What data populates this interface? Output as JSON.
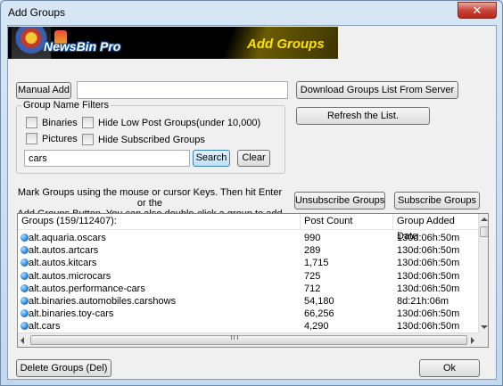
{
  "window": {
    "title": "Add Groups",
    "close_glyph": "✕"
  },
  "banner": {
    "logo_text": "NewsBin Pro",
    "title": "Add Groups"
  },
  "manual_add": {
    "label": "Manual Add",
    "value": ""
  },
  "server_buttons": {
    "download": "Download Groups List From Server",
    "refresh": "Refresh the List."
  },
  "filters": {
    "legend": "Group Name Filters",
    "binaries": "Binaries",
    "pictures": "Pictures",
    "hide_low": "Hide Low Post Groups(under 10,000)",
    "hide_subscribed": "Hide Subscribed Groups",
    "search_value": "cars",
    "search_button": "Search",
    "clear_button": "Clear"
  },
  "instructions": {
    "line1": "Mark Groups using the mouse or cursor Keys. Then hit Enter or the",
    "line2": "Add Groups Button. You can also double-click a group to add it."
  },
  "actions": {
    "unsubscribe": "Unsubscribe Groups",
    "subscribe": "Subscribe Groups"
  },
  "list": {
    "columns": [
      "Groups (159/112407):",
      "Post Count",
      "Group Added Date"
    ],
    "rows": [
      {
        "name": "alt.aquaria.oscars",
        "count": "990",
        "date": "130d:06h:50m"
      },
      {
        "name": "alt.autos.artcars",
        "count": "289",
        "date": "130d:06h:50m"
      },
      {
        "name": "alt.autos.kitcars",
        "count": "1,715",
        "date": "130d:06h:50m"
      },
      {
        "name": "alt.autos.microcars",
        "count": "725",
        "date": "130d:06h:50m"
      },
      {
        "name": "alt.autos.performance-cars",
        "count": "712",
        "date": "130d:06h:50m"
      },
      {
        "name": "alt.binaries.automobiles.carshows",
        "count": "54,180",
        "date": "8d:21h:06m"
      },
      {
        "name": "alt.binaries.toy-cars",
        "count": "66,256",
        "date": "130d:06h:50m"
      },
      {
        "name": "alt.cars",
        "count": "4,290",
        "date": "130d:06h:50m"
      }
    ]
  },
  "footer": {
    "delete": "Delete Groups (Del)",
    "ok": "Ok"
  }
}
